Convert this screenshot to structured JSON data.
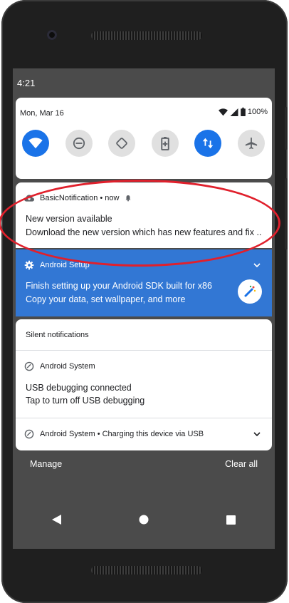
{
  "status": {
    "time": "4:21",
    "date": "Mon, Mar 16",
    "battery": "100%"
  },
  "quick_settings": {
    "tiles": [
      {
        "name": "wifi",
        "icon": "wifi-icon",
        "active": true
      },
      {
        "name": "do-not-disturb",
        "icon": "dnd-icon",
        "active": false
      },
      {
        "name": "auto-rotate",
        "icon": "rotate-icon",
        "active": false
      },
      {
        "name": "battery-saver",
        "icon": "battery-saver-icon",
        "active": false
      },
      {
        "name": "mobile-data",
        "icon": "data-arrows-icon",
        "active": true
      },
      {
        "name": "airplane-mode",
        "icon": "airplane-icon",
        "active": false
      }
    ]
  },
  "notifications": {
    "basic": {
      "app": "BasicNotification",
      "meta": " • now ",
      "title": "New version available",
      "text": "Download the new version which has new features and fix .."
    },
    "setup": {
      "app": "Android Setup",
      "title": "Finish setting up your Android SDK built for x86",
      "text": "Copy your data, set wallpaper, and more"
    },
    "silent": {
      "header": "Silent notifications",
      "usb": {
        "app": "Android System",
        "title": "USB debugging connected",
        "text": "Tap to turn off USB debugging"
      },
      "charging": {
        "app_line": "Android System • Charging this device via USB"
      }
    }
  },
  "actions": {
    "manage": "Manage",
    "clear_all": "Clear all"
  },
  "colors": {
    "accent": "#1a73e8",
    "setup_bg": "#3277d4",
    "annotation": "#e0202c"
  }
}
